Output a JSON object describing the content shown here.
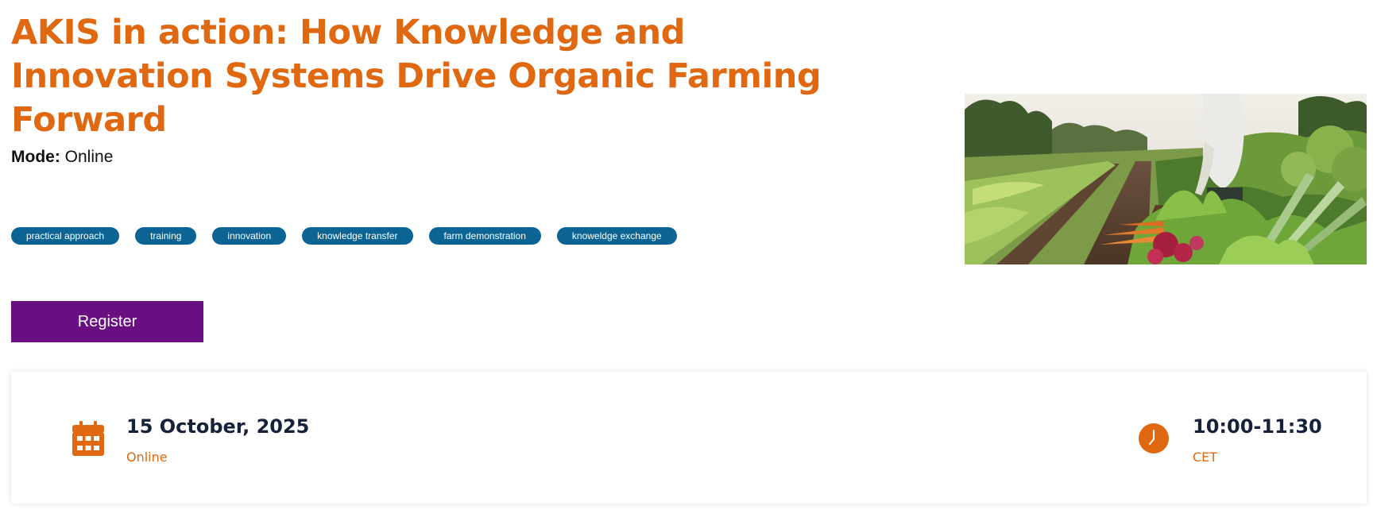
{
  "event": {
    "title": "AKIS in action: How Knowledge and Innovation Systems Drive Organic Farming Forward",
    "mode_label": "Mode:",
    "mode_value": "Online",
    "tags": [
      "practical approach",
      "training",
      "innovation",
      "knowledge transfer",
      "farm demonstration",
      "knoweldge exchange"
    ],
    "register_label": "Register"
  },
  "details": {
    "date": "15 October, 2025",
    "date_sub": "Online",
    "time": "10:00-11:30",
    "time_sub": "CET",
    "date_icon": "calendar-icon",
    "time_icon": "clock-icon"
  },
  "colors": {
    "title": "#e06811",
    "accent": "#e06811",
    "tag_bg": "#0b6494",
    "register_bg": "#6a0f82",
    "detail_text": "#16213a"
  }
}
